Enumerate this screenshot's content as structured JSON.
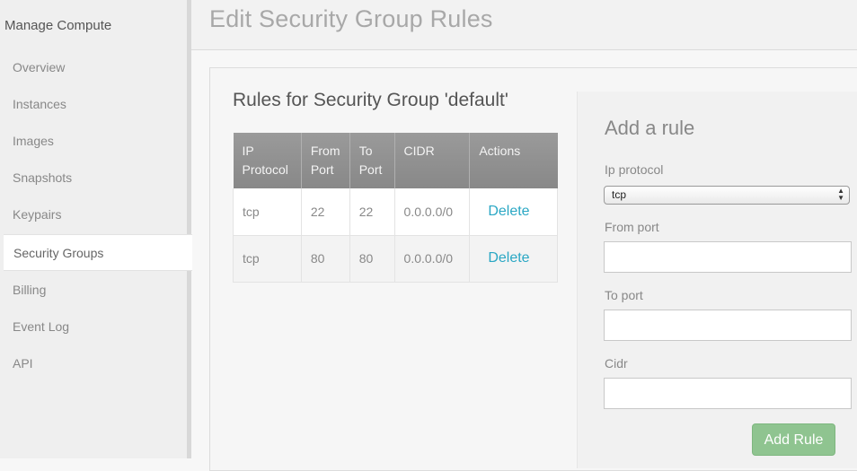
{
  "sidebar": {
    "title": "Manage Compute",
    "items": [
      {
        "label": "Overview"
      },
      {
        "label": "Instances"
      },
      {
        "label": "Images"
      },
      {
        "label": "Snapshots"
      },
      {
        "label": "Keypairs"
      },
      {
        "label": "Security Groups",
        "active": true
      },
      {
        "label": "Billing"
      },
      {
        "label": "Event Log"
      },
      {
        "label": "API"
      }
    ]
  },
  "header": {
    "title": "Edit Security Group Rules"
  },
  "rules": {
    "title": "Rules for Security Group 'default'",
    "columns": [
      {
        "line1": "IP",
        "line2": "Protocol"
      },
      {
        "line1": "From",
        "line2": "Port"
      },
      {
        "line1": "To",
        "line2": "Port"
      },
      {
        "line1": "CIDR",
        "line2": ""
      },
      {
        "line1": "Actions",
        "line2": ""
      }
    ],
    "rows": [
      {
        "protocol": "tcp",
        "from_port": "22",
        "to_port": "22",
        "cidr": "0.0.0.0/0",
        "action": "Delete"
      },
      {
        "protocol": "tcp",
        "from_port": "80",
        "to_port": "80",
        "cidr": "0.0.0.0/0",
        "action": "Delete"
      }
    ]
  },
  "add_rule": {
    "title": "Add a rule",
    "ip_protocol_label": "Ip protocol",
    "ip_protocol_value": "tcp",
    "from_port_label": "From port",
    "from_port_value": "",
    "to_port_label": "To port",
    "to_port_value": "",
    "cidr_label": "Cidr",
    "cidr_value": "",
    "button_label": "Add Rule"
  },
  "colors": {
    "accent_link": "#2aa7c4",
    "add_button": "#8fc490",
    "table_header": "#909090"
  }
}
